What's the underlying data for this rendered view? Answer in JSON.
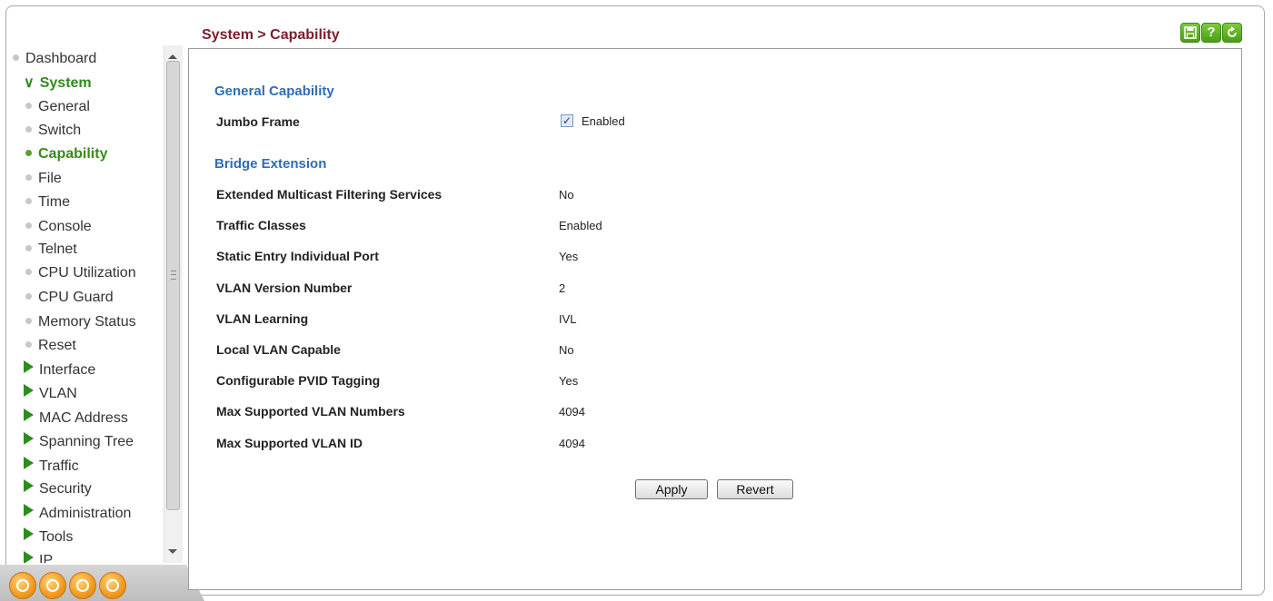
{
  "page_title": "System > Capability",
  "sidebar": {
    "items": [
      {
        "label": "Dashboard"
      },
      {
        "label": "System"
      },
      {
        "label": "General"
      },
      {
        "label": "Switch"
      },
      {
        "label": "Capability"
      },
      {
        "label": "File"
      },
      {
        "label": "Time"
      },
      {
        "label": "Console"
      },
      {
        "label": "Telnet"
      },
      {
        "label": "CPU Utilization"
      },
      {
        "label": "CPU Guard"
      },
      {
        "label": "Memory Status"
      },
      {
        "label": "Reset"
      },
      {
        "label": "Interface"
      },
      {
        "label": "VLAN"
      },
      {
        "label": "MAC Address"
      },
      {
        "label": "Spanning Tree"
      },
      {
        "label": "Traffic"
      },
      {
        "label": "Security"
      },
      {
        "label": "Administration"
      },
      {
        "label": "Tools"
      },
      {
        "label": "IP"
      }
    ]
  },
  "toolbar": {
    "save_icon": "save-icon",
    "help_label": "?",
    "refresh_icon": "refresh-icon"
  },
  "general_capability": {
    "title": "General Capability",
    "jumbo_frame_label": "Jumbo Frame",
    "jumbo_frame_checked": true,
    "jumbo_frame_value": "Enabled"
  },
  "bridge_extension": {
    "title": "Bridge Extension",
    "rows": [
      {
        "label": "Extended Multicast Filtering Services",
        "value": "No"
      },
      {
        "label": "Traffic Classes",
        "value": "Enabled"
      },
      {
        "label": "Static Entry Individual Port",
        "value": "Yes"
      },
      {
        "label": "VLAN Version Number",
        "value": "2"
      },
      {
        "label": "VLAN Learning",
        "value": "IVL"
      },
      {
        "label": "Local VLAN Capable",
        "value": "No"
      },
      {
        "label": "Configurable PVID Tagging",
        "value": "Yes"
      },
      {
        "label": "Max Supported VLAN Numbers",
        "value": "4094"
      },
      {
        "label": "Max Supported VLAN ID",
        "value": "4094"
      }
    ]
  },
  "buttons": {
    "apply": "Apply",
    "revert": "Revert"
  },
  "colors": {
    "title": "#7a1e2b",
    "section": "#2f6db4",
    "nav_active": "#3a8a1c",
    "toolbar_green": "#5aae24",
    "orange": "#f19a1d"
  }
}
